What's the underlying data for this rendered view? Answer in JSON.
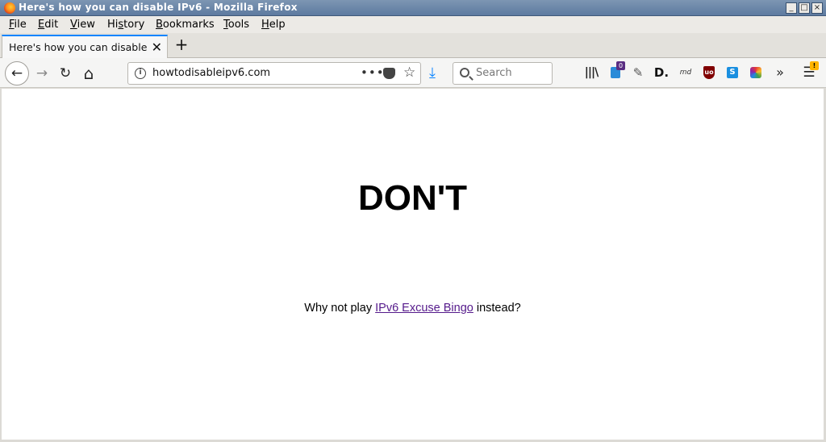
{
  "window": {
    "title": "Here's how you can disable IPv6 - Mozilla Firefox",
    "buttons": {
      "minimize": "_",
      "maximize": "□",
      "close": "×"
    }
  },
  "menu": [
    {
      "label": "File",
      "accel": "F",
      "rest": "ile"
    },
    {
      "label": "Edit",
      "accel": "E",
      "rest": "dit"
    },
    {
      "label": "View",
      "accel": "V",
      "rest": "iew"
    },
    {
      "label": "History",
      "accel": "s",
      "pre": "Hi",
      "rest": "tory"
    },
    {
      "label": "Bookmarks",
      "accel": "B",
      "rest": "ookmarks"
    },
    {
      "label": "Tools",
      "accel": "T",
      "rest": "ools"
    },
    {
      "label": "Help",
      "accel": "H",
      "rest": "elp"
    }
  ],
  "tab": {
    "title": "Here's how you can disable IPv6",
    "close_glyph": "✕"
  },
  "newtab_glyph": "+",
  "nav": {
    "back": "←",
    "forward": "→",
    "reload": "↻",
    "home": "⌂",
    "url": "howtodisableipv6.com",
    "page_actions": "•••",
    "bookmark_star": "☆",
    "download": "⤓",
    "search_placeholder": "Search"
  },
  "toolbar": {
    "library": "|||\\",
    "ext1_badge": "0",
    "eyedropper": "✎",
    "ext_d": "D.",
    "ext_md": "md",
    "ublock": "uo",
    "ext_s": "S",
    "overflow": "»",
    "menu": "☰",
    "menu_warning": "!"
  },
  "page": {
    "headline": "DON'T",
    "sub_before": "Why not play ",
    "sub_link": "IPv6 Excuse Bingo",
    "sub_after": " instead?"
  },
  "colors": {
    "link_visited": "#551a8b",
    "tab_accent": "#0a84ff"
  }
}
